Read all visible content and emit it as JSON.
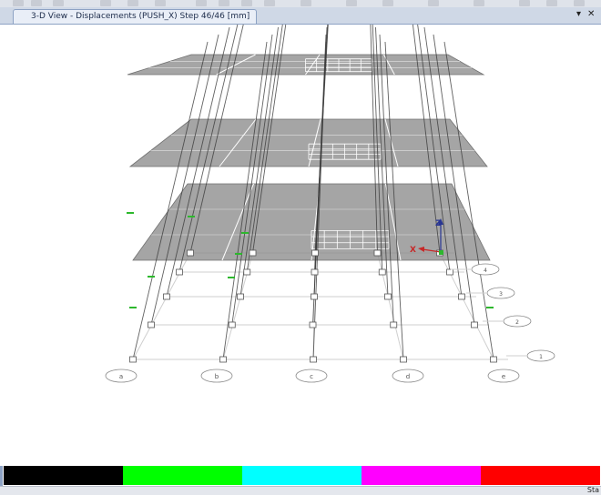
{
  "window": {
    "tab_title": "3-D View  - Displacements (PUSH_X)  Step 46/46  [mm]",
    "pin_glyph": "▾",
    "close_glyph": "✕"
  },
  "model": {
    "grid_bubbles": [
      "a",
      "b",
      "c",
      "d",
      "e"
    ],
    "side_bubbles": [
      "1",
      "2",
      "3",
      "4"
    ],
    "axis_labels": {
      "x": "X",
      "z": "Z"
    }
  },
  "legend": {
    "colors": [
      "#000000",
      "#00ff00",
      "#00ffff",
      "#ff00ff",
      "#ff0000"
    ]
  },
  "status": {
    "text": "Sta"
  },
  "colors": {
    "slab": "#8c8c8c",
    "grid": "#cfcfcf",
    "column": "#3a3a3a",
    "axis_x": "#c62828",
    "axis_z": "#283593",
    "hinge": "#2db82d"
  }
}
